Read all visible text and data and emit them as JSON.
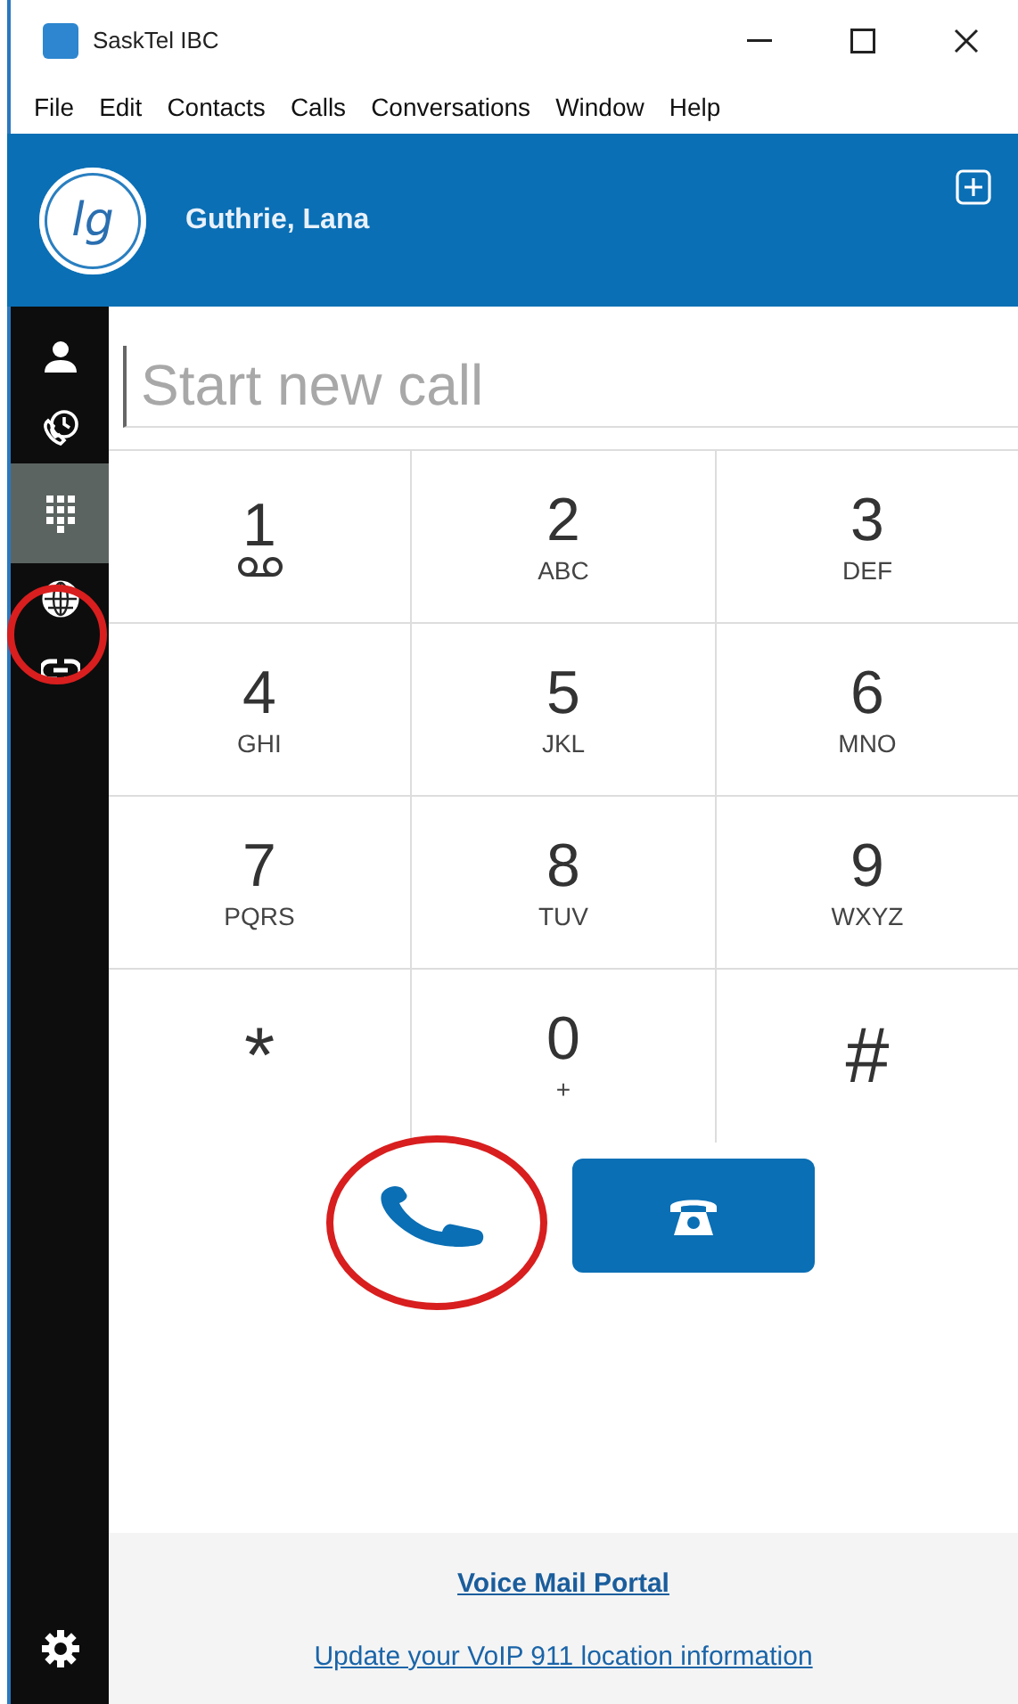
{
  "window": {
    "title": "SaskTel IBC"
  },
  "menu": [
    "File",
    "Edit",
    "Contacts",
    "Calls",
    "Conversations",
    "Window",
    "Help"
  ],
  "user": {
    "initials": "lg",
    "name": "Guthrie, Lana"
  },
  "sidebar": {
    "items": [
      {
        "kind": "contacts",
        "selected": false
      },
      {
        "kind": "history",
        "selected": false
      },
      {
        "kind": "dialpad",
        "selected": true
      },
      {
        "kind": "globe",
        "selected": false
      },
      {
        "kind": "link",
        "selected": false
      }
    ]
  },
  "call_field": {
    "placeholder": "Start new call"
  },
  "keypad": [
    {
      "digit": "1",
      "kind": "voicemail"
    },
    {
      "digit": "2",
      "letters": "ABC"
    },
    {
      "digit": "3",
      "letters": "DEF"
    },
    {
      "digit": "4",
      "letters": "GHI"
    },
    {
      "digit": "5",
      "letters": "JKL"
    },
    {
      "digit": "6",
      "letters": "MNO"
    },
    {
      "digit": "7",
      "letters": "PQRS"
    },
    {
      "digit": "8",
      "letters": "TUV"
    },
    {
      "digit": "9",
      "letters": "WXYZ"
    },
    {
      "digit": "*"
    },
    {
      "digit": "0",
      "letters": "+"
    },
    {
      "digit": "#"
    }
  ],
  "links": [
    "Voice Mail Portal",
    "Update your VoIP 911 location information"
  ]
}
